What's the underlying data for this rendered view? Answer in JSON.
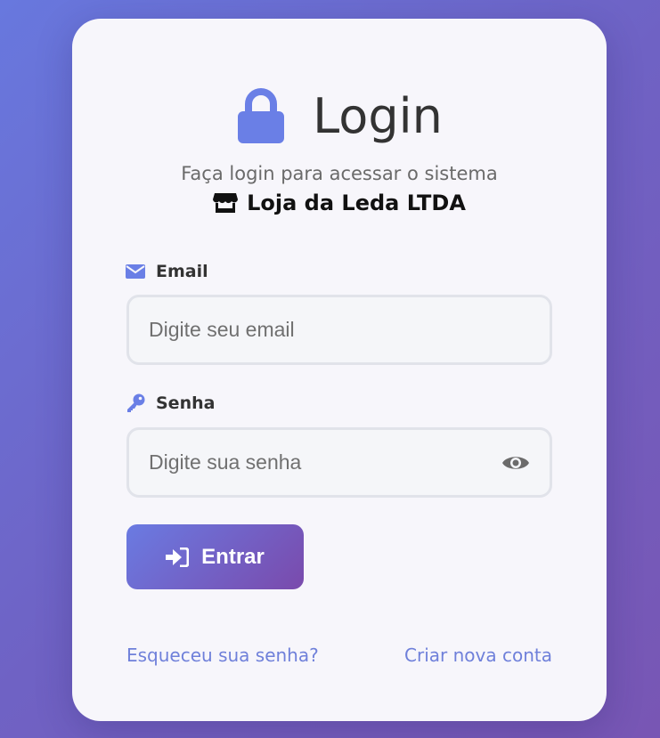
{
  "header": {
    "title": "Login",
    "subtitle": "Faça login para acessar o sistema",
    "store_name": "Loja da Leda LTDA",
    "title_icon": "lock-icon",
    "store_icon": "store-icon"
  },
  "form": {
    "email": {
      "label": "Email",
      "placeholder": "Digite seu email",
      "value": "",
      "icon": "envelope-icon"
    },
    "password": {
      "label": "Senha",
      "placeholder": "Digite sua senha",
      "value": "",
      "icon": "key-icon",
      "toggle_icon": "eye-icon"
    },
    "submit": {
      "label": "Entrar",
      "icon": "sign-in-icon"
    }
  },
  "links": {
    "forgot": "Esqueceu sua senha?",
    "create": "Criar nova conta"
  },
  "colors": {
    "accent": "#6a7be2",
    "link": "#6f80da",
    "background_start": "#6878de",
    "background_end": "#7856b4",
    "card": "#f7f6fb"
  }
}
